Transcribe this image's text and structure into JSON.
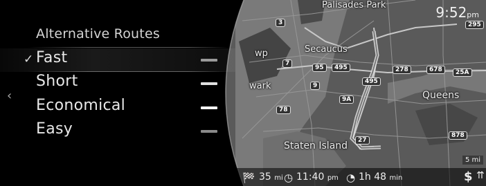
{
  "menu": {
    "title": "Alternative Routes",
    "items": [
      {
        "label": "Fast",
        "checked": true,
        "swatch_color": "#9a9a9a"
      },
      {
        "label": "Short",
        "checked": false,
        "swatch_color": "#e0e0e0"
      },
      {
        "label": "Economical",
        "checked": false,
        "swatch_color": "#ffffff"
      },
      {
        "label": "Easy",
        "checked": false,
        "swatch_color": "#8a8a8a"
      }
    ],
    "check_glyph": "✓",
    "back_glyph": "‹"
  },
  "clock": {
    "time": "9:52",
    "ampm": "pm"
  },
  "map": {
    "labels": [
      "Palisades Park",
      "Secaucus",
      "Queens",
      "Staten Island",
      "wp",
      "wark"
    ],
    "shields": [
      "3",
      "295",
      "7",
      "95",
      "495",
      "278",
      "678",
      "25A",
      "9",
      "495",
      "9A",
      "78",
      "878",
      "27"
    ],
    "scale": "5 mi"
  },
  "trip": {
    "distance_value": "35",
    "distance_unit": "mi",
    "arrival_value": "11:40",
    "arrival_unit": "pm",
    "duration_value": "1h 48",
    "duration_unit": "min",
    "toll_symbol": "$"
  }
}
